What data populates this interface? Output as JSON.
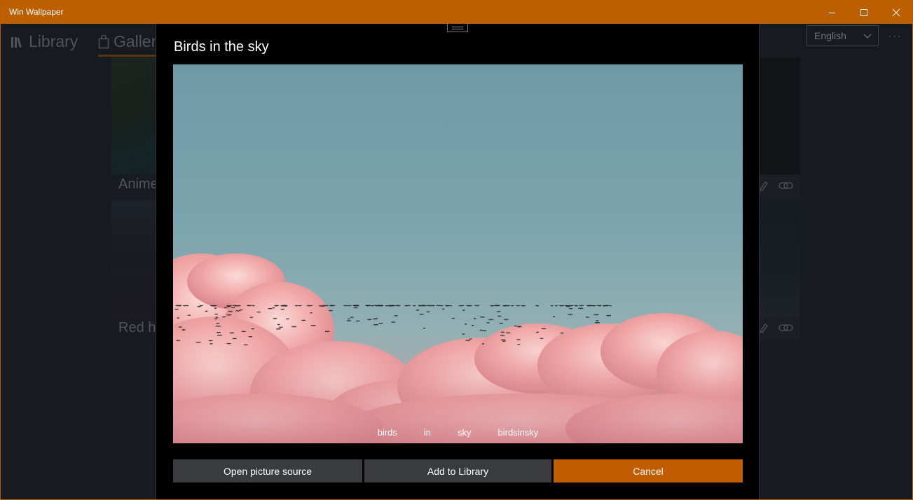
{
  "window": {
    "title": "Win Wallpaper",
    "accent": "#bd5e00",
    "controls": {
      "minimize": "minimize-icon",
      "maximize": "maximize-icon",
      "close": "close-icon"
    }
  },
  "app": {
    "nav": [
      {
        "label": "Library",
        "icon": "library-icon"
      },
      {
        "label": "Galler",
        "icon": "gallery-bag-icon"
      }
    ],
    "language": "English",
    "more_menu": "..."
  },
  "background_cards": [
    {
      "label": "Anime"
    },
    {
      "label": "Red h"
    }
  ],
  "dialog": {
    "title": "Birds in the sky",
    "tags": [
      "birds",
      "in",
      "sky",
      "birdsinsky"
    ],
    "buttons": {
      "open_source": "Open picture source",
      "add_library": "Add to Library",
      "cancel": "Cancel"
    }
  }
}
